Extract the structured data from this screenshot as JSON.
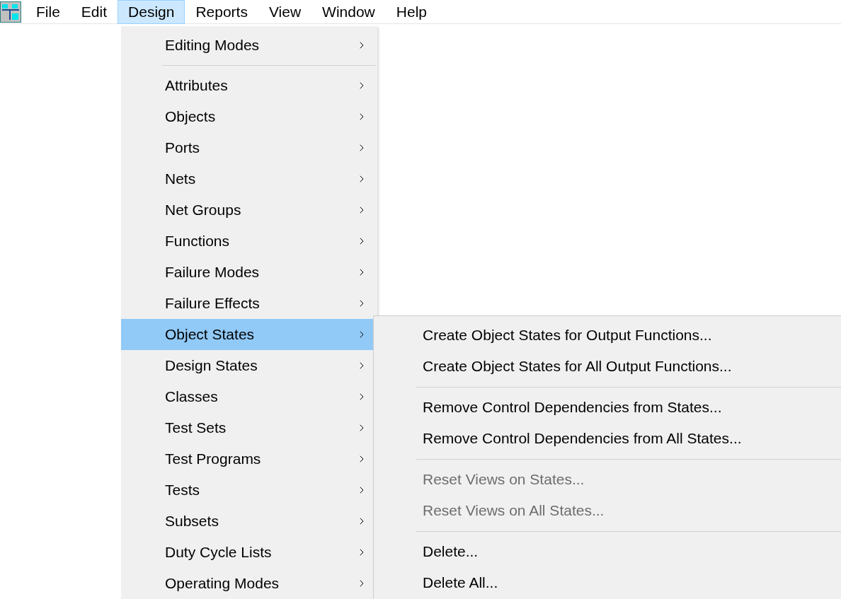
{
  "menubar": [
    {
      "label": "File",
      "selected": false
    },
    {
      "label": "Edit",
      "selected": false
    },
    {
      "label": "Design",
      "selected": true
    },
    {
      "label": "Reports",
      "selected": false
    },
    {
      "label": "View",
      "selected": false
    },
    {
      "label": "Window",
      "selected": false
    },
    {
      "label": "Help",
      "selected": false
    }
  ],
  "design_menu": [
    {
      "kind": "item",
      "label": "Editing Modes",
      "selected": false
    },
    {
      "kind": "separator"
    },
    {
      "kind": "item",
      "label": "Attributes",
      "selected": false
    },
    {
      "kind": "item",
      "label": "Objects",
      "selected": false
    },
    {
      "kind": "item",
      "label": "Ports",
      "selected": false
    },
    {
      "kind": "item",
      "label": "Nets",
      "selected": false
    },
    {
      "kind": "item",
      "label": "Net Groups",
      "selected": false
    },
    {
      "kind": "item",
      "label": "Functions",
      "selected": false
    },
    {
      "kind": "item",
      "label": "Failure Modes",
      "selected": false
    },
    {
      "kind": "item",
      "label": "Failure Effects",
      "selected": false
    },
    {
      "kind": "item",
      "label": "Object States",
      "selected": true
    },
    {
      "kind": "item",
      "label": "Design States",
      "selected": false
    },
    {
      "kind": "item",
      "label": "Classes",
      "selected": false
    },
    {
      "kind": "item",
      "label": "Test Sets",
      "selected": false
    },
    {
      "kind": "item",
      "label": "Test Programs",
      "selected": false
    },
    {
      "kind": "item",
      "label": "Tests",
      "selected": false
    },
    {
      "kind": "item",
      "label": "Subsets",
      "selected": false
    },
    {
      "kind": "item",
      "label": "Duty Cycle Lists",
      "selected": false
    },
    {
      "kind": "item",
      "label": "Operating Modes",
      "selected": false
    }
  ],
  "object_states_submenu": [
    {
      "kind": "item",
      "label": "Create Object States for Output Functions...",
      "disabled": false
    },
    {
      "kind": "item",
      "label": "Create Object States for All Output Functions...",
      "disabled": false
    },
    {
      "kind": "separator"
    },
    {
      "kind": "item",
      "label": "Remove Control Dependencies from States...",
      "disabled": false
    },
    {
      "kind": "item",
      "label": "Remove Control Dependencies from All States...",
      "disabled": false
    },
    {
      "kind": "separator"
    },
    {
      "kind": "item",
      "label": "Reset Views on States...",
      "disabled": true
    },
    {
      "kind": "item",
      "label": "Reset Views on All States...",
      "disabled": true
    },
    {
      "kind": "separator"
    },
    {
      "kind": "item",
      "label": "Delete...",
      "disabled": false
    },
    {
      "kind": "item",
      "label": "Delete All...",
      "disabled": false
    }
  ]
}
